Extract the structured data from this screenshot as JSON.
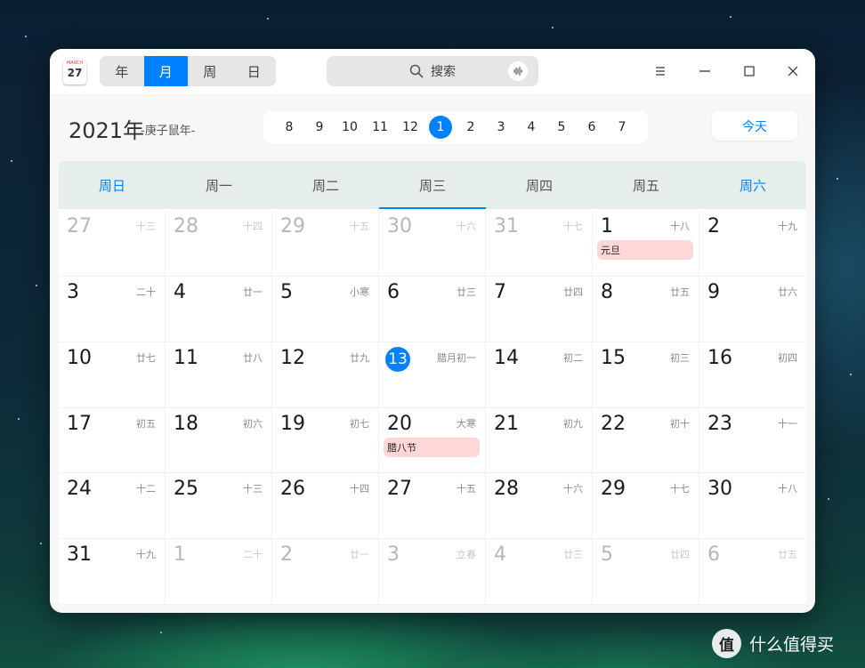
{
  "app": {
    "icon": {
      "month": "MARCH",
      "day": "27"
    }
  },
  "toolbar": {
    "views": [
      {
        "label": "年",
        "active": false
      },
      {
        "label": "月",
        "active": true
      },
      {
        "label": "周",
        "active": false
      },
      {
        "label": "日",
        "active": false
      }
    ],
    "search_label": "搜索"
  },
  "header": {
    "year": "2021年",
    "year_sub": "-庚子鼠年-",
    "months": [
      "8",
      "9",
      "10",
      "11",
      "12",
      "1",
      "2",
      "3",
      "4",
      "5",
      "6",
      "7"
    ],
    "current_month": "1",
    "today_label": "今天"
  },
  "weekdays": [
    {
      "label": "周日",
      "weekend": true
    },
    {
      "label": "周一",
      "weekend": false
    },
    {
      "label": "周二",
      "weekend": false
    },
    {
      "label": "周三",
      "weekend": false,
      "today": true
    },
    {
      "label": "周四",
      "weekend": false
    },
    {
      "label": "周五",
      "weekend": false
    },
    {
      "label": "周六",
      "weekend": true
    }
  ],
  "days": [
    {
      "d": "27",
      "l": "十三",
      "o": true
    },
    {
      "d": "28",
      "l": "十四",
      "o": true
    },
    {
      "d": "29",
      "l": "十五",
      "o": true
    },
    {
      "d": "30",
      "l": "十六",
      "o": true
    },
    {
      "d": "31",
      "l": "十七",
      "o": true
    },
    {
      "d": "1",
      "l": "十八",
      "e": "元旦"
    },
    {
      "d": "2",
      "l": "十九"
    },
    {
      "d": "3",
      "l": "二十"
    },
    {
      "d": "4",
      "l": "廿一"
    },
    {
      "d": "5",
      "l": "小寒"
    },
    {
      "d": "6",
      "l": "廿三"
    },
    {
      "d": "7",
      "l": "廿四"
    },
    {
      "d": "8",
      "l": "廿五"
    },
    {
      "d": "9",
      "l": "廿六"
    },
    {
      "d": "10",
      "l": "廿七"
    },
    {
      "d": "11",
      "l": "廿八"
    },
    {
      "d": "12",
      "l": "廿九"
    },
    {
      "d": "13",
      "l": "腊月初一",
      "t": true
    },
    {
      "d": "14",
      "l": "初二"
    },
    {
      "d": "15",
      "l": "初三"
    },
    {
      "d": "16",
      "l": "初四"
    },
    {
      "d": "17",
      "l": "初五"
    },
    {
      "d": "18",
      "l": "初六"
    },
    {
      "d": "19",
      "l": "初七"
    },
    {
      "d": "20",
      "l": "大寒",
      "e": "腊八节"
    },
    {
      "d": "21",
      "l": "初九"
    },
    {
      "d": "22",
      "l": "初十"
    },
    {
      "d": "23",
      "l": "十一"
    },
    {
      "d": "24",
      "l": "十二"
    },
    {
      "d": "25",
      "l": "十三"
    },
    {
      "d": "26",
      "l": "十四"
    },
    {
      "d": "27",
      "l": "十五"
    },
    {
      "d": "28",
      "l": "十六"
    },
    {
      "d": "29",
      "l": "十七"
    },
    {
      "d": "30",
      "l": "十八"
    },
    {
      "d": "31",
      "l": "十九"
    },
    {
      "d": "1",
      "l": "二十",
      "o": true
    },
    {
      "d": "2",
      "l": "廿一",
      "o": true
    },
    {
      "d": "3",
      "l": "立春",
      "o": true
    },
    {
      "d": "4",
      "l": "廿三",
      "o": true
    },
    {
      "d": "5",
      "l": "廿四",
      "o": true
    },
    {
      "d": "6",
      "l": "廿五",
      "o": true
    }
  ],
  "watermark": {
    "badge": "值",
    "text": "什么值得买"
  },
  "colors": {
    "accent": "#0081ff",
    "event_bg": "#ffd7d7",
    "weekday_header_bg": "#e5eeea"
  },
  "icons": {
    "search": "search-icon",
    "voice": "voice-wave-icon",
    "menu": "menu-icon",
    "minimize": "minimize-icon",
    "maximize": "maximize-icon",
    "close": "close-icon"
  }
}
